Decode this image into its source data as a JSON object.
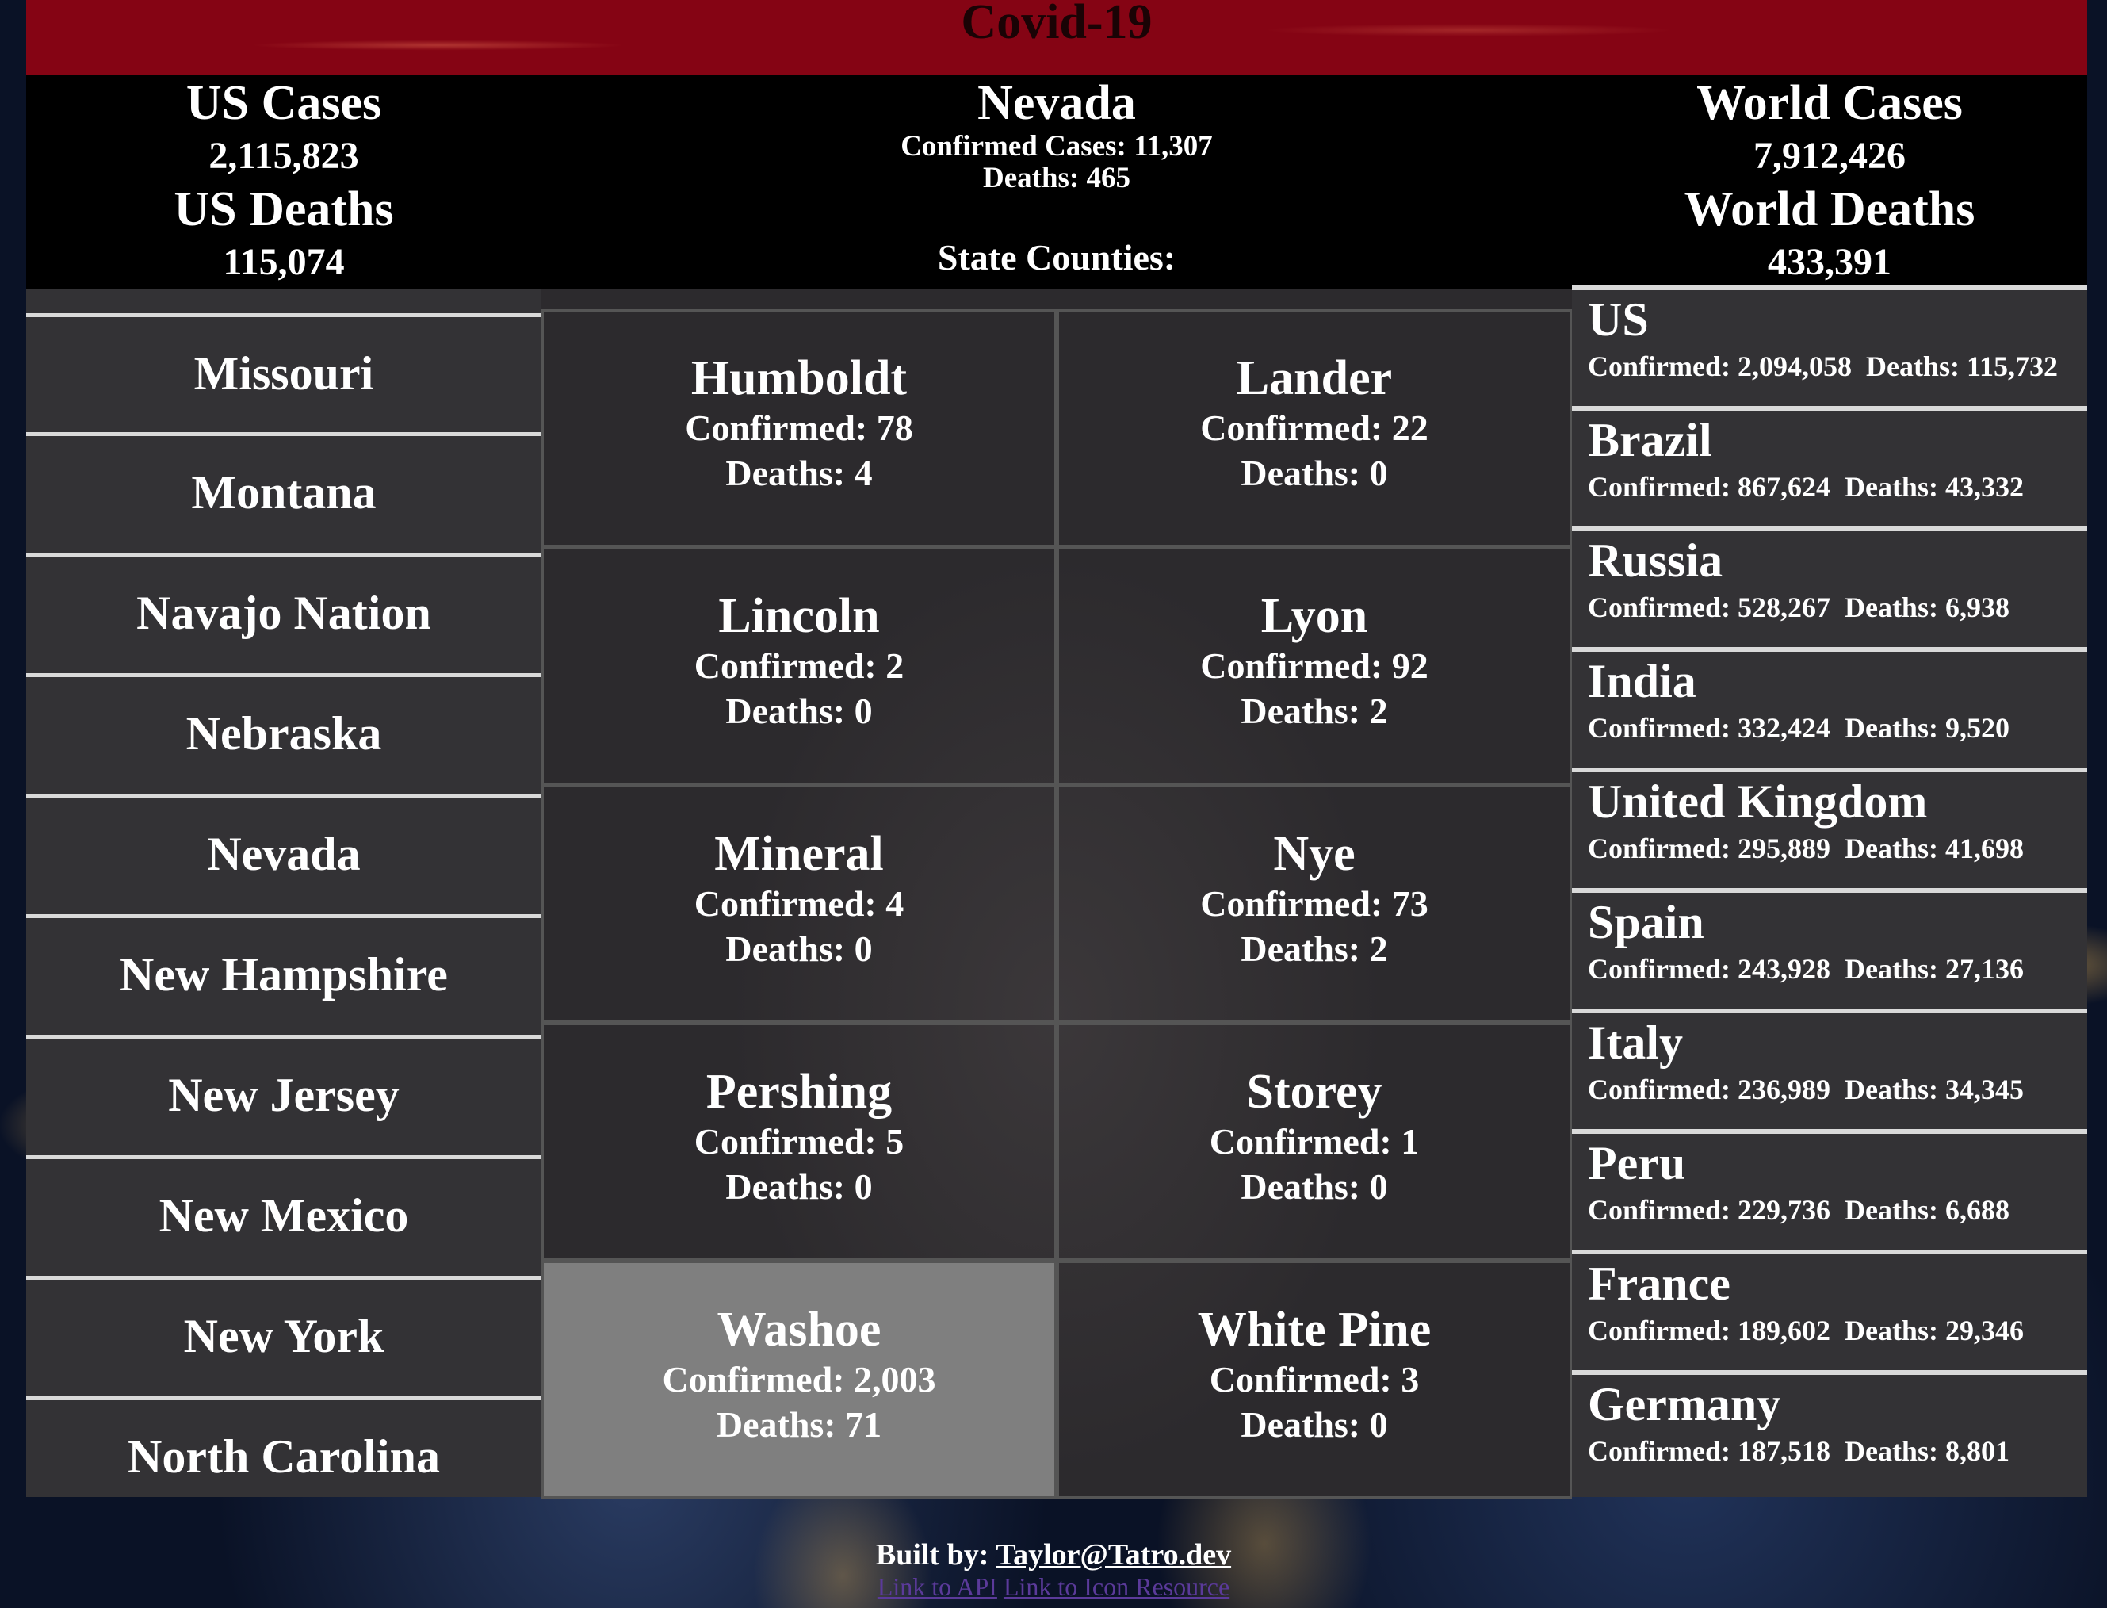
{
  "banner": {
    "title": "Covid-19"
  },
  "us": {
    "cases_label": "US Cases",
    "cases": "2,115,823",
    "deaths_label": "US Deaths",
    "deaths": "115,074"
  },
  "state": {
    "name": "Nevada",
    "confirmed_line": "Confirmed Cases: 11,307",
    "deaths_line": "Deaths: 465",
    "counties_label": "State Counties:"
  },
  "world": {
    "cases_label": "World Cases",
    "cases": "7,912,426",
    "deaths_label": "World Deaths",
    "deaths": "433,391"
  },
  "states_list": [
    "Missouri",
    "Montana",
    "Navajo Nation",
    "Nebraska",
    "Nevada",
    "New Hampshire",
    "New Jersey",
    "New Mexico",
    "New York",
    "North Carolina"
  ],
  "counties": [
    {
      "name": "Humboldt",
      "confirmed": "Confirmed: 78",
      "deaths": "Deaths: 4"
    },
    {
      "name": "Lander",
      "confirmed": "Confirmed: 22",
      "deaths": "Deaths: 0"
    },
    {
      "name": "Lincoln",
      "confirmed": "Confirmed: 2",
      "deaths": "Deaths: 0"
    },
    {
      "name": "Lyon",
      "confirmed": "Confirmed: 92",
      "deaths": "Deaths: 2"
    },
    {
      "name": "Mineral",
      "confirmed": "Confirmed: 4",
      "deaths": "Deaths: 0"
    },
    {
      "name": "Nye",
      "confirmed": "Confirmed: 73",
      "deaths": "Deaths: 2"
    },
    {
      "name": "Pershing",
      "confirmed": "Confirmed: 5",
      "deaths": "Deaths: 0"
    },
    {
      "name": "Storey",
      "confirmed": "Confirmed: 1",
      "deaths": "Deaths: 0"
    },
    {
      "name": "Washoe",
      "confirmed": "Confirmed: 2,003",
      "deaths": "Deaths: 71"
    },
    {
      "name": "White Pine",
      "confirmed": "Confirmed: 3",
      "deaths": "Deaths: 0"
    }
  ],
  "countries": [
    {
      "name": "US",
      "confirmed": "Confirmed: 2,094,058",
      "deaths": "Deaths: 115,732"
    },
    {
      "name": "Brazil",
      "confirmed": "Confirmed: 867,624",
      "deaths": "Deaths: 43,332"
    },
    {
      "name": "Russia",
      "confirmed": "Confirmed: 528,267",
      "deaths": "Deaths: 6,938"
    },
    {
      "name": "India",
      "confirmed": "Confirmed: 332,424",
      "deaths": "Deaths: 9,520"
    },
    {
      "name": "United Kingdom",
      "confirmed": "Confirmed: 295,889",
      "deaths": "Deaths: 41,698"
    },
    {
      "name": "Spain",
      "confirmed": "Confirmed: 243,928",
      "deaths": "Deaths: 27,136"
    },
    {
      "name": "Italy",
      "confirmed": "Confirmed: 236,989",
      "deaths": "Deaths: 34,345"
    },
    {
      "name": "Peru",
      "confirmed": "Confirmed: 229,736",
      "deaths": "Deaths: 6,688"
    },
    {
      "name": "France",
      "confirmed": "Confirmed: 189,602",
      "deaths": "Deaths: 29,346"
    },
    {
      "name": "Germany",
      "confirmed": "Confirmed: 187,518",
      "deaths": "Deaths: 8,801"
    }
  ],
  "footer": {
    "built_by": "Built by:",
    "author_link": "Taylor@Tatro.dev",
    "api_link": "Link to API",
    "icon_link": "Link to Icon Resource"
  }
}
